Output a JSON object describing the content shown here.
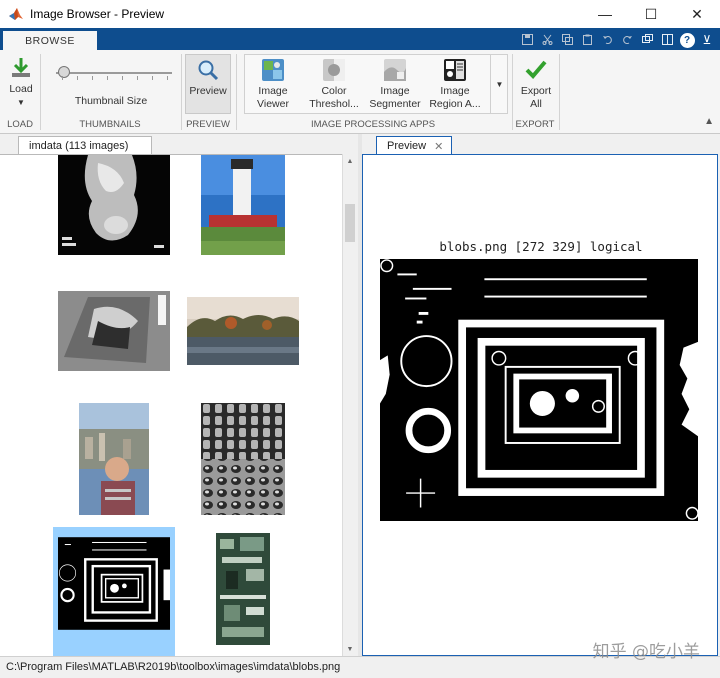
{
  "window": {
    "title": "Image Browser - Preview",
    "controls": {
      "minimize": "—",
      "maximize": "☐",
      "close": "✕"
    }
  },
  "ribbon_tabs": [
    {
      "label": "BROWSE"
    }
  ],
  "quick_access": {
    "help": "?",
    "pin": "⊻"
  },
  "ribbon": {
    "load": {
      "label": "Load",
      "group": "LOAD"
    },
    "thumbnails": {
      "label": "Thumbnail Size",
      "group": "THUMBNAILS",
      "slider_value_fraction": 0.05
    },
    "preview": {
      "label": "Preview",
      "group": "PREVIEW"
    },
    "apps": {
      "group": "IMAGE PROCESSING APPS",
      "items": [
        {
          "line1": "Image",
          "line2": "Viewer"
        },
        {
          "line1": "Color",
          "line2": "Threshol..."
        },
        {
          "line1": "Image",
          "line2": "Segmenter"
        },
        {
          "line1": "Image",
          "line2": "Region A..."
        }
      ]
    },
    "export": {
      "line1": "Export",
      "line2": "All",
      "group": "EXPORT"
    }
  },
  "left_pane": {
    "tab": "imdata (113 images)",
    "selected_index": 6
  },
  "right_pane": {
    "tab": "Preview",
    "caption": "blobs.png   [272  329] logical"
  },
  "status": {
    "path": "C:\\Program Files\\MATLAB\\R2019b\\toolbox\\images\\imdata\\blobs.png"
  },
  "watermark": "知乎 @吃小羊",
  "colors": {
    "tab_strip": "#0e4d8e",
    "selection": "#99d1ff",
    "preview_border": "#1b61b3",
    "export_check": "#33a12e"
  }
}
